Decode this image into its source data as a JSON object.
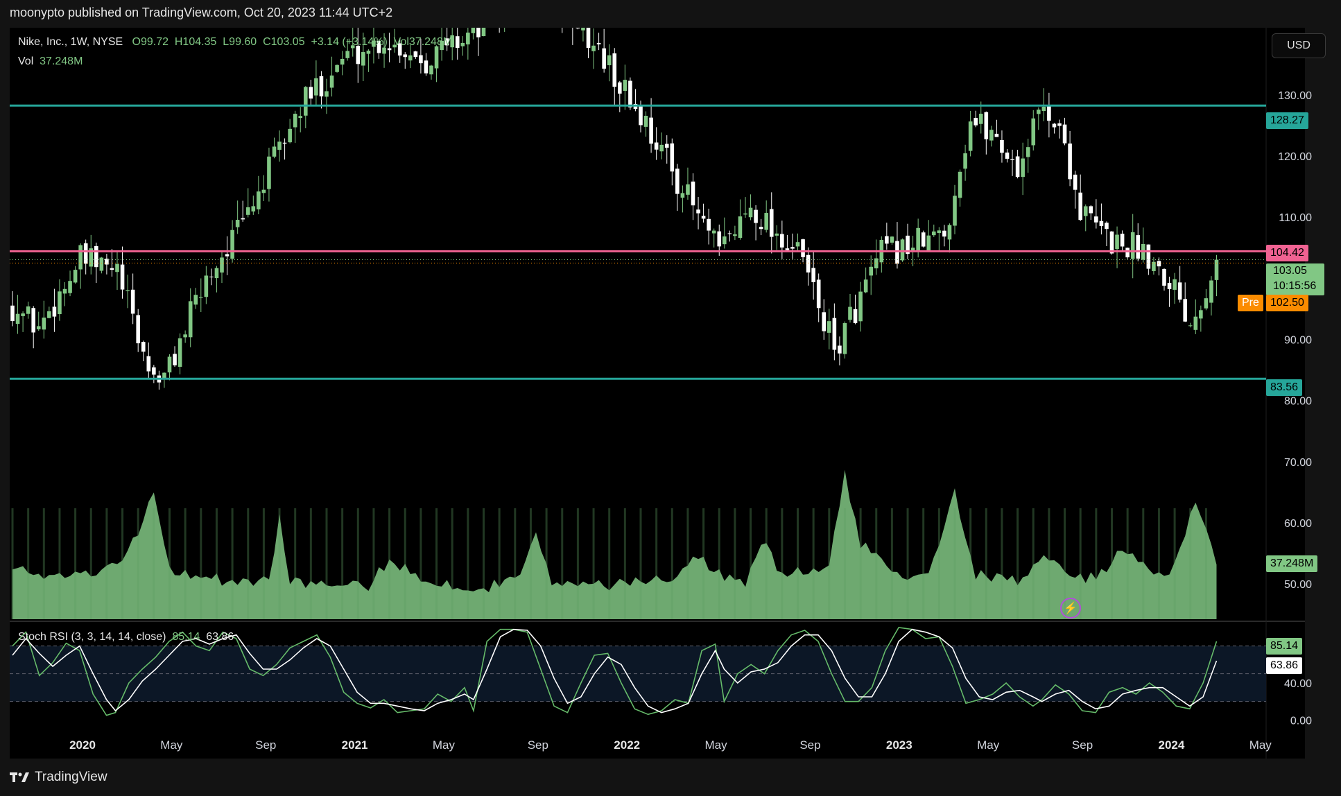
{
  "header": {
    "publisher": "moonypto published on TradingView.com, Oct 20, 2023 11:44 UTC+2"
  },
  "currency_button": "USD",
  "legend": {
    "symbol": "Nike, Inc., 1W, NYSE",
    "open": "O99.72",
    "high": "H104.35",
    "low": "L99.60",
    "close": "C103.05",
    "change": "+3.14 (+3.14%)",
    "vol_inline": "Vol37.248M",
    "vol_label": "Vol",
    "vol_value": "37.248M"
  },
  "stoch_legend": {
    "name": "Stoch RSI (3, 3, 14, 14, close)",
    "k": "85.14",
    "d": "63.86"
  },
  "price_labels": {
    "resistance_top": "128.27",
    "resistance_mid": "104.42",
    "last_price": "103.05",
    "countdown": "10:15:56",
    "pre_tag": "Pre",
    "pre_price": "102.50",
    "support": "83.56",
    "volume": "37.248M",
    "stoch_k": "85.14",
    "stoch_d": "63.86"
  },
  "footer": {
    "brand": "TradingView"
  },
  "colors": {
    "teal_line": "#26a69a",
    "pink_line": "#f06292",
    "bull": "#81c784",
    "bear": "#ffffff",
    "pre": "#fb8c00",
    "volume_fill": "#81c784",
    "stoch_k": "#66bb6a",
    "stoch_d": "#ffffff"
  },
  "icons": {
    "footer_logo": "tradingview-logo-icon",
    "replay": "lightning-icon"
  },
  "chart_data": [
    {
      "type": "candlestick",
      "title": "Nike, Inc., 1W, NYSE",
      "ylim": [
        44,
        141
      ],
      "y_ticks": [
        50,
        60,
        70,
        80,
        90,
        100,
        110,
        120,
        130
      ],
      "y_tick_labels": [
        "50.00",
        "60.00",
        "70.00",
        "80.00",
        "90.00",
        "110.00",
        "120.00",
        "130.00"
      ],
      "x_tick_labels": [
        "2020",
        "May",
        "Sep",
        "2021",
        "May",
        "Sep",
        "2022",
        "May",
        "Sep",
        "2023",
        "May",
        "Sep",
        "2024",
        "May"
      ],
      "horizontal_lines": [
        {
          "value": 128.27,
          "color": "#26a69a"
        },
        {
          "value": 104.42,
          "color": "#f06292"
        },
        {
          "value": 83.56,
          "color": "#26a69a"
        }
      ],
      "last_close": 103.05,
      "pre_market": 102.5,
      "anchors": [
        [
          0,
          95.5
        ],
        [
          5,
          92
        ],
        [
          13,
          103
        ],
        [
          20,
          101
        ],
        [
          26,
          85
        ],
        [
          29,
          83.5
        ],
        [
          37,
          100
        ],
        [
          44,
          109
        ],
        [
          55,
          128
        ],
        [
          63,
          136
        ],
        [
          71,
          139
        ],
        [
          79,
          136
        ],
        [
          102,
          148
        ],
        [
          112,
          137
        ],
        [
          122,
          124
        ],
        [
          135,
          104
        ],
        [
          141,
          112
        ],
        [
          151,
          103
        ],
        [
          157,
          88
        ],
        [
          166,
          104
        ],
        [
          178,
          107
        ],
        [
          183,
          126
        ],
        [
          187,
          124
        ],
        [
          192,
          118
        ],
        [
          197,
          129
        ],
        [
          201,
          122
        ],
        [
          204,
          111
        ],
        [
          210,
          106
        ],
        [
          216,
          105
        ],
        [
          222,
          99
        ],
        [
          225,
          93
        ],
        [
          230,
          103.05
        ]
      ],
      "volume": {
        "last_label": "37.248M",
        "levels": [
          [
            0,
            0.33
          ],
          [
            5,
            0.3
          ],
          [
            12,
            0.3
          ],
          [
            20,
            0.35
          ],
          [
            24,
            0.6
          ],
          [
            27,
            0.85
          ],
          [
            30,
            0.34
          ],
          [
            35,
            0.3
          ],
          [
            42,
            0.25
          ],
          [
            49,
            0.25
          ],
          [
            51,
            0.68
          ],
          [
            53,
            0.27
          ],
          [
            60,
            0.22
          ],
          [
            68,
            0.22
          ],
          [
            72,
            0.4
          ],
          [
            80,
            0.25
          ],
          [
            90,
            0.2
          ],
          [
            97,
            0.33
          ],
          [
            100,
            0.55
          ],
          [
            103,
            0.25
          ],
          [
            110,
            0.22
          ],
          [
            120,
            0.25
          ],
          [
            127,
            0.3
          ],
          [
            130,
            0.45
          ],
          [
            135,
            0.3
          ],
          [
            140,
            0.25
          ],
          [
            143,
            0.53
          ],
          [
            147,
            0.3
          ],
          [
            156,
            0.35
          ],
          [
            159,
            0.97
          ],
          [
            162,
            0.5
          ],
          [
            170,
            0.3
          ],
          [
            175,
            0.32
          ],
          [
            180,
            0.85
          ],
          [
            184,
            0.3
          ],
          [
            192,
            0.25
          ],
          [
            197,
            0.45
          ],
          [
            202,
            0.25
          ],
          [
            208,
            0.3
          ],
          [
            212,
            0.48
          ],
          [
            218,
            0.3
          ],
          [
            222,
            0.35
          ],
          [
            226,
            0.78
          ],
          [
            230,
            0.37
          ]
        ]
      }
    },
    {
      "type": "line",
      "title": "Stoch RSI (3, 3, 14, 14, close)",
      "ylim": [
        -5,
        100
      ],
      "y_tick_labels": [
        "40.00",
        "0.00"
      ],
      "band": [
        20,
        80
      ],
      "series": [
        {
          "name": "K",
          "color": "#66bb6a",
          "points": [
            [
              0,
              80
            ],
            [
              3,
              95
            ],
            [
              6,
              48
            ],
            [
              9,
              62
            ],
            [
              12,
              83
            ],
            [
              15,
              75
            ],
            [
              18,
              28
            ],
            [
              21,
              5
            ],
            [
              23,
              8
            ],
            [
              26,
              40
            ],
            [
              29,
              55
            ],
            [
              32,
              68
            ],
            [
              35,
              85
            ],
            [
              38,
              95
            ],
            [
              41,
              80
            ],
            [
              44,
              75
            ],
            [
              47,
              95
            ],
            [
              50,
              88
            ],
            [
              53,
              55
            ],
            [
              56,
              48
            ],
            [
              59,
              60
            ],
            [
              62,
              78
            ],
            [
              65,
              85
            ],
            [
              68,
              92
            ],
            [
              71,
              68
            ],
            [
              74,
              30
            ],
            [
              77,
              18
            ],
            [
              80,
              13
            ],
            [
              83,
              22
            ],
            [
              86,
              8
            ],
            [
              89,
              10
            ],
            [
              92,
              12
            ],
            [
              95,
              28
            ],
            [
              98,
              20
            ],
            [
              101,
              35
            ],
            [
              103,
              10
            ],
            [
              106,
              85
            ],
            [
              109,
              98
            ],
            [
              112,
              98
            ],
            [
              115,
              95
            ],
            [
              118,
              55
            ],
            [
              121,
              15
            ],
            [
              124,
              8
            ],
            [
              127,
              40
            ],
            [
              130,
              70
            ],
            [
              133,
              72
            ],
            [
              136,
              40
            ],
            [
              139,
              12
            ],
            [
              142,
              6
            ],
            [
              145,
              10
            ],
            [
              148,
              22
            ],
            [
              151,
              18
            ],
            [
              154,
              75
            ],
            [
              157,
              82
            ],
            [
              159,
              20
            ],
            [
              162,
              50
            ],
            [
              165,
              60
            ],
            [
              168,
              50
            ],
            [
              171,
              75
            ],
            [
              174,
              92
            ],
            [
              177,
              97
            ],
            [
              180,
              85
            ],
            [
              183,
              50
            ],
            [
              186,
              20
            ],
            [
              189,
              20
            ],
            [
              192,
              35
            ],
            [
              195,
              75
            ],
            [
              198,
              100
            ],
            [
              201,
              98
            ],
            [
              204,
              88
            ],
            [
              207,
              90
            ],
            [
              210,
              58
            ],
            [
              213,
              18
            ],
            [
              216,
              22
            ],
            [
              219,
              28
            ],
            [
              222,
              40
            ],
            [
              225,
              25
            ],
            [
              228,
              15
            ],
            [
              230,
              22
            ],
            [
              233,
              38
            ],
            [
              236,
              28
            ],
            [
              239,
              10
            ],
            [
              242,
              8
            ],
            [
              245,
              30
            ],
            [
              248,
              35
            ],
            [
              251,
              28
            ],
            [
              254,
              40
            ],
            [
              257,
              30
            ],
            [
              260,
              15
            ],
            [
              263,
              12
            ],
            [
              266,
              40
            ],
            [
              269,
              85
            ]
          ]
        },
        {
          "name": "D",
          "color": "#ffffff",
          "points": [
            [
              0,
              70
            ],
            [
              3,
              88
            ],
            [
              6,
              72
            ],
            [
              9,
              58
            ],
            [
              12,
              70
            ],
            [
              15,
              80
            ],
            [
              18,
              50
            ],
            [
              21,
              22
            ],
            [
              23,
              10
            ],
            [
              26,
              22
            ],
            [
              29,
              42
            ],
            [
              32,
              55
            ],
            [
              35,
              70
            ],
            [
              38,
              85
            ],
            [
              41,
              88
            ],
            [
              44,
              82
            ],
            [
              47,
              88
            ],
            [
              50,
              92
            ],
            [
              53,
              72
            ],
            [
              56,
              55
            ],
            [
              59,
              55
            ],
            [
              62,
              65
            ],
            [
              65,
              78
            ],
            [
              68,
              88
            ],
            [
              71,
              80
            ],
            [
              74,
              55
            ],
            [
              77,
              30
            ],
            [
              80,
              18
            ],
            [
              83,
              18
            ],
            [
              86,
              15
            ],
            [
              89,
              12
            ],
            [
              92,
              10
            ],
            [
              95,
              18
            ],
            [
              98,
              22
            ],
            [
              101,
              28
            ],
            [
              103,
              22
            ],
            [
              106,
              55
            ],
            [
              109,
              90
            ],
            [
              112,
              98
            ],
            [
              115,
              97
            ],
            [
              118,
              80
            ],
            [
              121,
              45
            ],
            [
              124,
              18
            ],
            [
              127,
              25
            ],
            [
              130,
              50
            ],
            [
              133,
              68
            ],
            [
              136,
              60
            ],
            [
              139,
              35
            ],
            [
              142,
              15
            ],
            [
              145,
              8
            ],
            [
              148,
              12
            ],
            [
              151,
              18
            ],
            [
              154,
              50
            ],
            [
              157,
              75
            ],
            [
              159,
              55
            ],
            [
              162,
              40
            ],
            [
              165,
              52
            ],
            [
              168,
              55
            ],
            [
              171,
              62
            ],
            [
              174,
              80
            ],
            [
              177,
              92
            ],
            [
              180,
              92
            ],
            [
              183,
              75
            ],
            [
              186,
              45
            ],
            [
              189,
              25
            ],
            [
              192,
              25
            ],
            [
              195,
              50
            ],
            [
              198,
              85
            ],
            [
              201,
              98
            ],
            [
              204,
              95
            ],
            [
              207,
              90
            ],
            [
              210,
              78
            ],
            [
              213,
              45
            ],
            [
              216,
              25
            ],
            [
              219,
              22
            ],
            [
              222,
              30
            ],
            [
              225,
              32
            ],
            [
              228,
              25
            ],
            [
              230,
              20
            ],
            [
              233,
              28
            ],
            [
              236,
              32
            ],
            [
              239,
              20
            ],
            [
              242,
              12
            ],
            [
              245,
              15
            ],
            [
              248,
              28
            ],
            [
              251,
              32
            ],
            [
              254,
              35
            ],
            [
              257,
              35
            ],
            [
              260,
              25
            ],
            [
              263,
              15
            ],
            [
              266,
              25
            ],
            [
              269,
              64
            ]
          ]
        }
      ]
    }
  ]
}
